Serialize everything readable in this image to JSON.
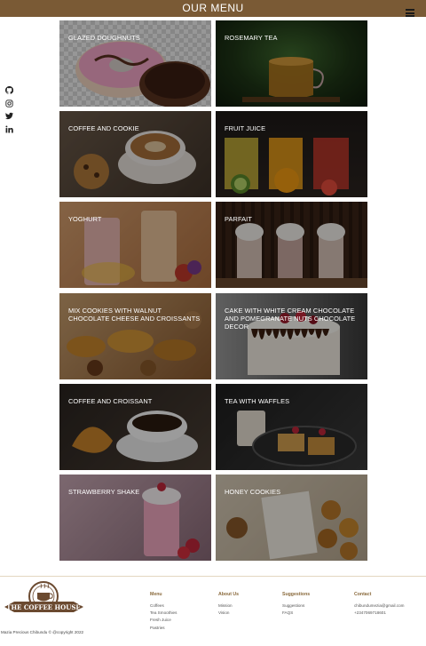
{
  "header": {
    "title": "OUR MENU",
    "menu_icon": "hamburger-icon",
    "bg_color": "#7a5a35"
  },
  "social": [
    {
      "name": "github-icon"
    },
    {
      "name": "instagram-icon"
    },
    {
      "name": "twitter-icon"
    },
    {
      "name": "linkedin-icon"
    }
  ],
  "menu_items": [
    {
      "label": "GLAZED DOUGHNUTS"
    },
    {
      "label": "ROSEMARY TEA"
    },
    {
      "label": "COFFEE AND COOKIE"
    },
    {
      "label": "FRUIT JUICE"
    },
    {
      "label": "YOGHURT"
    },
    {
      "label": "PARFAIT"
    },
    {
      "label": "MIX COOKIES WITH WALNUT CHOCOLATE CHEESE AND CROISSANTS"
    },
    {
      "label": "CAKE WITH WHITE CREAM CHOCOLATE AND POMEGRANATE NUTS CHOCOLATE DECOR"
    },
    {
      "label": "COFFEE AND CROISSANT"
    },
    {
      "label": "TEA WITH WAFFLES"
    },
    {
      "label": "STRAWBERRY SHAKE"
    },
    {
      "label": "HONEY COOKIES"
    }
  ],
  "footer": {
    "logo_text": "THE COFFEE HOUSE",
    "copyright": "Mazia Precious Chibundu © @copyright 2022",
    "columns": [
      {
        "heading": "Menu",
        "links": [
          "Coffees",
          "Tea Smoothies",
          "Fresh Juice",
          "Pastries"
        ]
      },
      {
        "heading": "About Us",
        "links": [
          "Mission",
          "Vision"
        ]
      },
      {
        "heading": "Suggestions",
        "links": [
          "Suggestions",
          "FAQS"
        ]
      },
      {
        "heading": "Contact",
        "links": [
          "chibundumezia@gmail.com",
          "+2347069718601"
        ]
      }
    ]
  }
}
